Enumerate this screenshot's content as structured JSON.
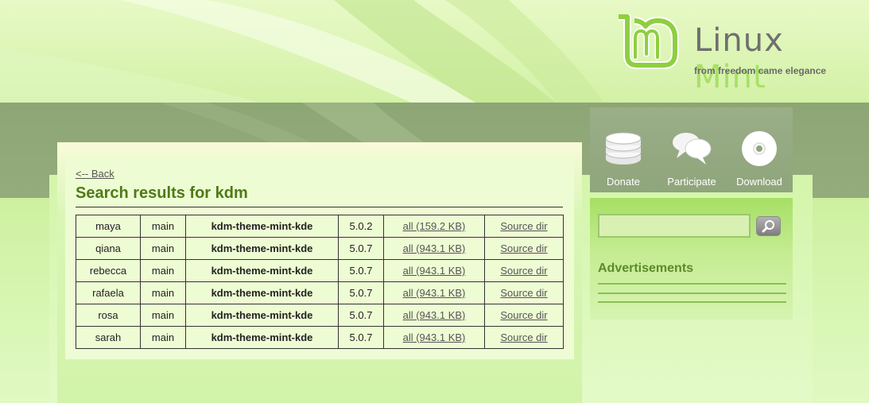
{
  "logo": {
    "word1": "Linux",
    "word2": "Mint",
    "tagline": "from freedom came elegance",
    "icon": "linux-mint-logo-icon"
  },
  "main": {
    "back_label": "<-- Back",
    "title": "Search results for kdm",
    "rows": [
      {
        "release": "maya",
        "section": "main",
        "package": "kdm-theme-mint-kde",
        "version": "5.0.2",
        "download": "all (159.2 KB)",
        "source": "Source dir"
      },
      {
        "release": "qiana",
        "section": "main",
        "package": "kdm-theme-mint-kde",
        "version": "5.0.7",
        "download": "all (943.1 KB)",
        "source": "Source dir"
      },
      {
        "release": "rebecca",
        "section": "main",
        "package": "kdm-theme-mint-kde",
        "version": "5.0.7",
        "download": "all (943.1 KB)",
        "source": "Source dir"
      },
      {
        "release": "rafaela",
        "section": "main",
        "package": "kdm-theme-mint-kde",
        "version": "5.0.7",
        "download": "all (943.1 KB)",
        "source": "Source dir"
      },
      {
        "release": "rosa",
        "section": "main",
        "package": "kdm-theme-mint-kde",
        "version": "5.0.7",
        "download": "all (943.1 KB)",
        "source": "Source dir"
      },
      {
        "release": "sarah",
        "section": "main",
        "package": "kdm-theme-mint-kde",
        "version": "5.0.7",
        "download": "all (943.1 KB)",
        "source": "Source dir"
      }
    ]
  },
  "sidebar": {
    "nav": [
      {
        "label": "Donate",
        "icon": "coins-icon"
      },
      {
        "label": "Participate",
        "icon": "speech-bubbles-icon"
      },
      {
        "label": "Download",
        "icon": "disc-icon"
      }
    ],
    "search": {
      "value": "",
      "placeholder": "",
      "button_icon": "magnifier-icon"
    },
    "ads_title": "Advertisements"
  },
  "colors": {
    "title_green": "#4e7a18",
    "ads_green": "#5d8a2a",
    "band": "#8ea675"
  }
}
